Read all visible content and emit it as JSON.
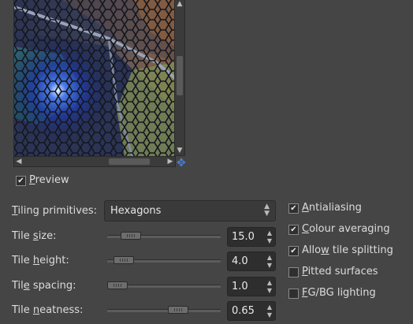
{
  "preview": {
    "checkbox_label_mnemonic": "P",
    "checkbox_label_rest": "review",
    "checked": true
  },
  "tiling": {
    "label_mnemonic": "T",
    "label_rest": "iling primitives:",
    "value": "Hexagons"
  },
  "params": [
    {
      "label_pre": "Tile ",
      "mnemonic": "s",
      "label_post": "ize:",
      "value": "15.0",
      "slider_fraction": 0.14
    },
    {
      "label_pre": "Tile ",
      "mnemonic": "h",
      "label_post": "eight:",
      "value": "4.0",
      "slider_fraction": 0.07
    },
    {
      "label_pre": "Til",
      "mnemonic": "e",
      "label_post": " spacing:",
      "value": "1.0",
      "slider_fraction": 0.0
    },
    {
      "label_pre": "Tile ",
      "mnemonic": "n",
      "label_post": "eatness:",
      "value": "0.65",
      "slider_fraction": 0.65
    }
  ],
  "options": [
    {
      "label_pre": "",
      "mnemonic": "A",
      "label_post": "ntialiasing",
      "checked": true
    },
    {
      "label_pre": "",
      "mnemonic": "C",
      "label_post": "olour averaging",
      "checked": true
    },
    {
      "label_pre": "Allo",
      "mnemonic": "w",
      "label_post": " tile splitting",
      "checked": true
    },
    {
      "label_pre": "",
      "mnemonic": "P",
      "label_post": "itted surfaces",
      "checked": false
    },
    {
      "label_pre": "",
      "mnemonic": "F",
      "label_post": "G/BG lighting",
      "checked": false
    }
  ],
  "icons": {
    "navigate": "navigate-icon",
    "scroll_up": "chevron-up-icon",
    "scroll_down": "chevron-down-icon",
    "scroll_left": "chevron-left-icon",
    "scroll_right": "chevron-right-icon",
    "combo_caret": "updown-icon",
    "check": "checkmark-icon"
  },
  "colors": {
    "background": "#454545",
    "nav_icon": "#4a7fd4"
  }
}
